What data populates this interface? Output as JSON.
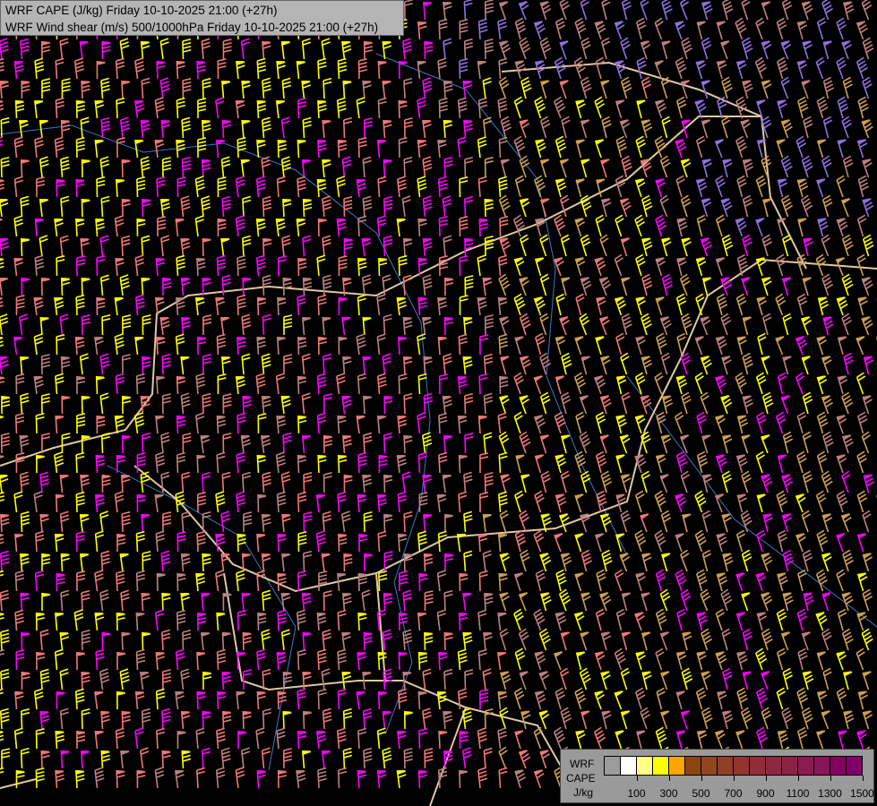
{
  "header": {
    "line1": "WRF CAPE (J/kg) Friday 10-10-2025 21:00 (+27h)",
    "line2": "WRF Wind shear (m/s) 500/1000hPa Friday 10-10-2025 21:00 (+27h)"
  },
  "legend": {
    "label1": "WRF",
    "label2": "CAPE",
    "unit": "J/kg",
    "colors": [
      "#9c9c9c",
      "#ffffff",
      "#ffff88",
      "#ffff00",
      "#ffa500",
      "#8b4513",
      "#8f4520",
      "#903e28",
      "#923530",
      "#902d38",
      "#8d2840",
      "#8a2246",
      "#881c4e",
      "#861657",
      "#84005f",
      "#80006a"
    ],
    "ticks": [
      "100",
      "300",
      "500",
      "700",
      "900",
      "1100",
      "1300",
      "1500"
    ]
  },
  "barb_colors": {
    "yellow": "#ffff00",
    "salmon": "#f07878",
    "magenta": "#ff00ff",
    "rose": "#c08080",
    "tan": "#d0a050",
    "purple": "#9070e0"
  }
}
